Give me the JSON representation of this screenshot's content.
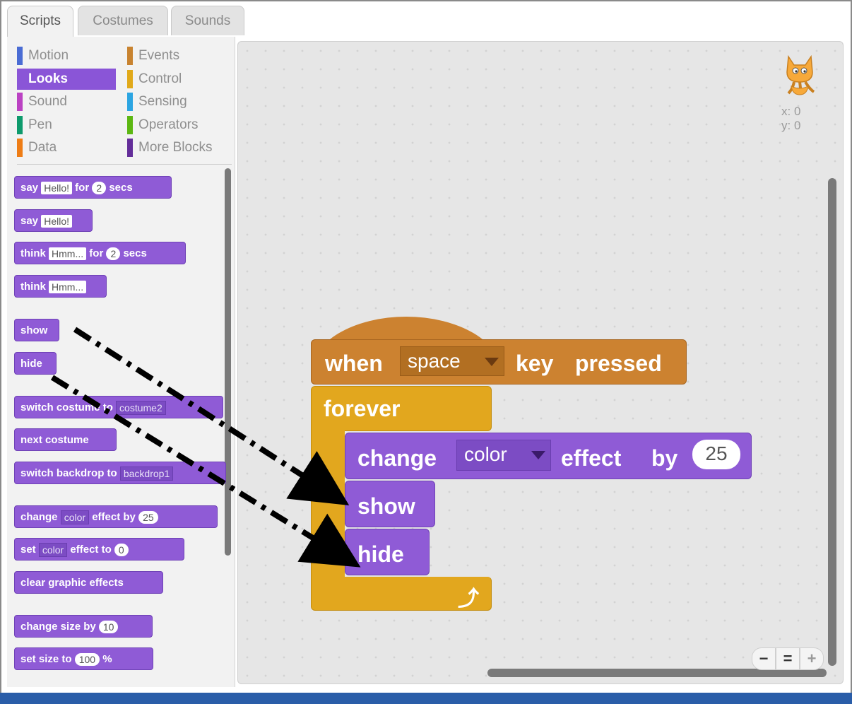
{
  "tabs": [
    "Scripts",
    "Costumes",
    "Sounds"
  ],
  "active_tab": "Scripts",
  "categories": [
    {
      "label": "Motion",
      "color": "#4a6cd4"
    },
    {
      "label": "Looks",
      "color": "#8a55d7",
      "selected": true
    },
    {
      "label": "Sound",
      "color": "#bb42c3"
    },
    {
      "label": "Pen",
      "color": "#0e9a6c"
    },
    {
      "label": "Data",
      "color": "#ee7d16"
    },
    {
      "label": "Events",
      "color": "#c88330"
    },
    {
      "label": "Control",
      "color": "#e1a91a"
    },
    {
      "label": "Sensing",
      "color": "#2ca5e2"
    },
    {
      "label": "Operators",
      "color": "#5cb712"
    },
    {
      "label": "More Blocks",
      "color": "#632d99"
    }
  ],
  "palette": {
    "say_for": {
      "say": "say",
      "value": "Hello!",
      "for": "for",
      "secs_value": "2",
      "secs": "secs"
    },
    "say": {
      "say": "say",
      "value": "Hello!"
    },
    "think_for": {
      "think": "think",
      "value": "Hmm...",
      "for": "for",
      "secs_value": "2",
      "secs": "secs"
    },
    "think": {
      "think": "think",
      "value": "Hmm..."
    },
    "show": "show",
    "hide": "hide",
    "switch_costume": {
      "label": "switch costume to",
      "value": "costume2"
    },
    "next_costume": "next costume",
    "switch_backdrop": {
      "label": "switch backdrop to",
      "value": "backdrop1"
    },
    "change_effect": {
      "change": "change",
      "effect_value": "color",
      "effect_by": "effect by",
      "amount": "25"
    },
    "set_effect": {
      "set": "set",
      "effect_value": "color",
      "effect_to": "effect to",
      "amount": "0"
    },
    "clear_effects": "clear graphic effects",
    "change_size": {
      "label": "change size by",
      "amount": "10"
    },
    "set_size": {
      "label": "set size to",
      "amount": "100",
      "unit": "%"
    }
  },
  "script": {
    "when": "when",
    "key": "space",
    "key_pressed_1": "key",
    "key_pressed_2": "pressed",
    "forever": "forever",
    "change": "change",
    "effect": "color",
    "effect_by_1": "effect",
    "effect_by_2": "by",
    "amount": "25",
    "show": "show",
    "hide": "hide"
  },
  "sprite": {
    "x": "x: 0",
    "y": "y: 0"
  },
  "zoom": {
    "out": "−",
    "reset": "=",
    "in": "+"
  }
}
